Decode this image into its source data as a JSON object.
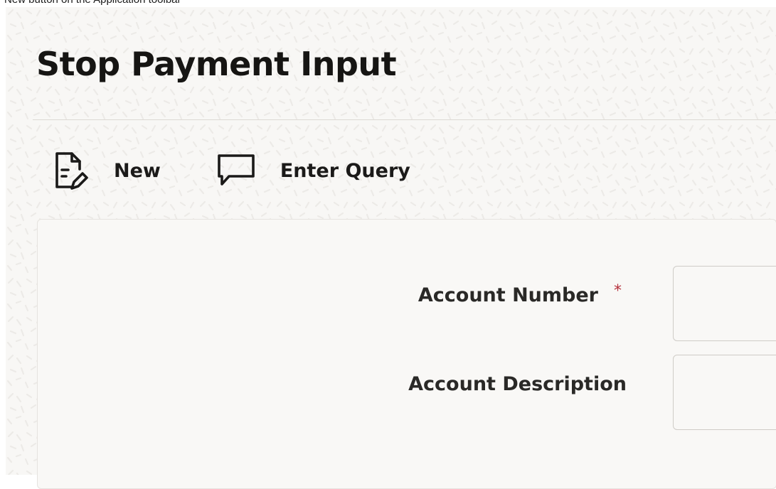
{
  "caption": "New button on the Application toolbar",
  "page": {
    "title": "Stop Payment Input"
  },
  "toolbar": {
    "new": {
      "label": "New",
      "icon": "new-document-icon"
    },
    "enter_query": {
      "label": "Enter Query",
      "icon": "speech-bubble-icon"
    }
  },
  "form": {
    "account_number": {
      "label": "Account Number",
      "required_marker": "*",
      "value": ""
    },
    "account_description": {
      "label": "Account Description",
      "value": ""
    }
  },
  "colors": {
    "background": "#f8f7f5",
    "text": "#161513",
    "required": "#b5313c",
    "border": "#cfccc7"
  }
}
